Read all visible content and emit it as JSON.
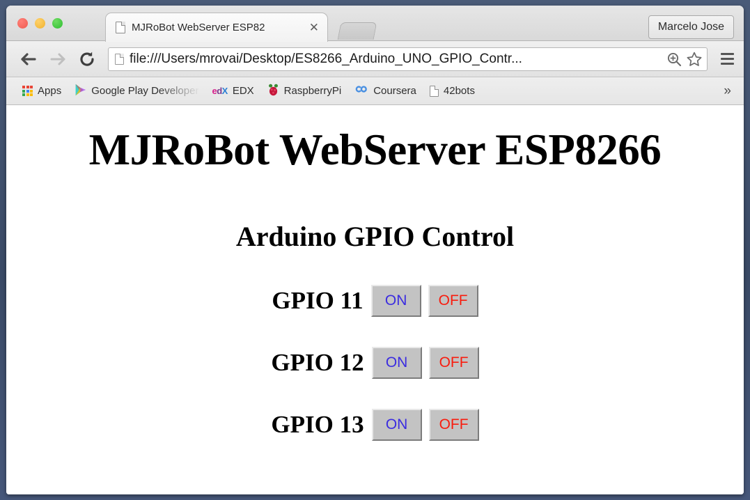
{
  "window": {
    "traffic_lights": [
      {
        "name": "close",
        "color": "#ef5b50"
      },
      {
        "name": "minimize",
        "color": "#f0b22e"
      },
      {
        "name": "zoom",
        "color": "#2fbd31"
      }
    ],
    "profile_button": "Marcelo Jose"
  },
  "tab": {
    "title": "MJRoBot WebServer ESP82",
    "close_label": "✕",
    "favicon": "document-icon",
    "new_tab_label": ""
  },
  "toolbar": {
    "back_icon": "back-arrow-icon",
    "forward_icon": "forward-arrow-icon",
    "reload_icon": "reload-icon",
    "url": "file:///Users/mrovai/Desktop/ES8266_Arduino_UNO_GPIO_Contr...",
    "url_placeholder": "Search Google or type a URL",
    "zoom_icon": "zoom-in-icon",
    "bookmark_star_icon": "star-icon",
    "menu_icon": "hamburger-menu-icon"
  },
  "bookmarks": {
    "items": [
      {
        "label": "Apps",
        "icon": "apps-grid-icon"
      },
      {
        "label": "Google Play Developer",
        "icon": "google-play-icon",
        "faded": true
      },
      {
        "label": "EDX",
        "icon": "edx-logo-icon"
      },
      {
        "label": "RaspberryPi",
        "icon": "raspberry-pi-icon"
      },
      {
        "label": "Coursera",
        "icon": "coursera-logo-icon"
      },
      {
        "label": "42bots",
        "icon": "document-icon"
      }
    ],
    "overflow_label": "»"
  },
  "page": {
    "title": "MJRoBot WebServer ESP8266",
    "subtitle": "Arduino GPIO Control",
    "on_label": "ON",
    "off_label": "OFF",
    "on_color": "#3b2ce0",
    "off_color": "#f81c0e",
    "button_bg": "#c3c3c3",
    "gpios": [
      {
        "label": "GPIO 11"
      },
      {
        "label": "GPIO 12"
      },
      {
        "label": "GPIO 13"
      }
    ]
  }
}
